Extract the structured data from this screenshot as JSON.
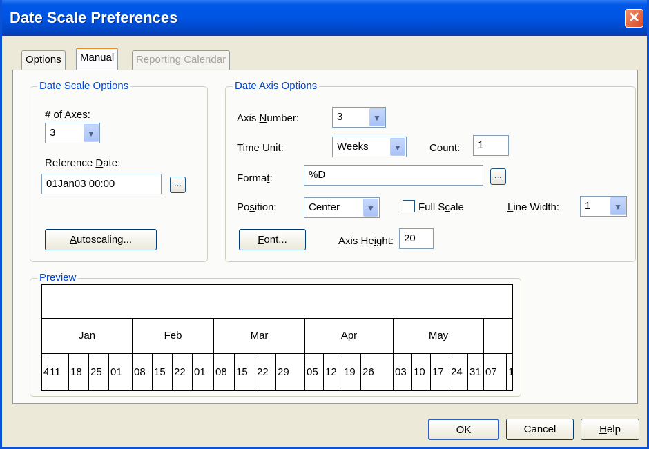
{
  "window": {
    "title": "Date Scale Preferences",
    "close_glyph": "✕"
  },
  "tabs": [
    {
      "label": "Options",
      "state": "normal"
    },
    {
      "label": "Manual",
      "state": "active"
    },
    {
      "label": "Reporting Calendar",
      "state": "disabled"
    }
  ],
  "date_scale": {
    "legend": "Date Scale Options",
    "axes_label_pre": "# of A",
    "axes_label_u": "x",
    "axes_label_post": "es:",
    "axes_value": "3",
    "ref_label_pre": "Reference ",
    "ref_label_u": "D",
    "ref_label_post": "ate:",
    "ref_value": "01Jan03 00:00",
    "ellipsis": "...",
    "autoscaling_u": "A",
    "autoscaling_rest": "utoscaling..."
  },
  "date_axis": {
    "legend": "Date Axis Options",
    "axis_number_pre": "Axis ",
    "axis_number_u": "N",
    "axis_number_post": "umber:",
    "axis_number_value": "3",
    "time_unit_pre": "T",
    "time_unit_u": "i",
    "time_unit_post": "me Unit:",
    "time_unit_value": "Weeks",
    "count_pre": "C",
    "count_u": "o",
    "count_post": "unt:",
    "count_value": "1",
    "format_pre": "Forma",
    "format_u": "t",
    "format_post": ":",
    "format_value": "%D",
    "position_pre": "Po",
    "position_u": "s",
    "position_post": "ition:",
    "position_value": "Center",
    "full_scale_pre": "Full S",
    "full_scale_u": "c",
    "full_scale_post": "ale",
    "full_scale_checked": false,
    "line_width_u": "L",
    "line_width_rest": "ine Width:",
    "line_width_value": "1",
    "font_u": "F",
    "font_rest": "ont...",
    "axis_height_pre": "Axis He",
    "axis_height_u": "i",
    "axis_height_post": "ght:",
    "axis_height_value": "20"
  },
  "preview": {
    "legend": "Preview",
    "months": [
      "Jan",
      "Feb",
      "Mar",
      "Apr",
      "May"
    ],
    "days": [
      "4",
      "11",
      "18",
      "25",
      "01",
      "08",
      "15",
      "22",
      "01",
      "08",
      "15",
      "22",
      "29",
      "05",
      "12",
      "19",
      "26",
      "03",
      "10",
      "17",
      "24",
      "31",
      "07",
      "1"
    ]
  },
  "footer": {
    "ok": "OK",
    "cancel": "Cancel",
    "help_u": "H",
    "help_rest": "elp"
  },
  "colors": {
    "title_bar": "#0054e3",
    "group_legend": "#0046d5",
    "dialog_bg": "#ece9d8"
  }
}
